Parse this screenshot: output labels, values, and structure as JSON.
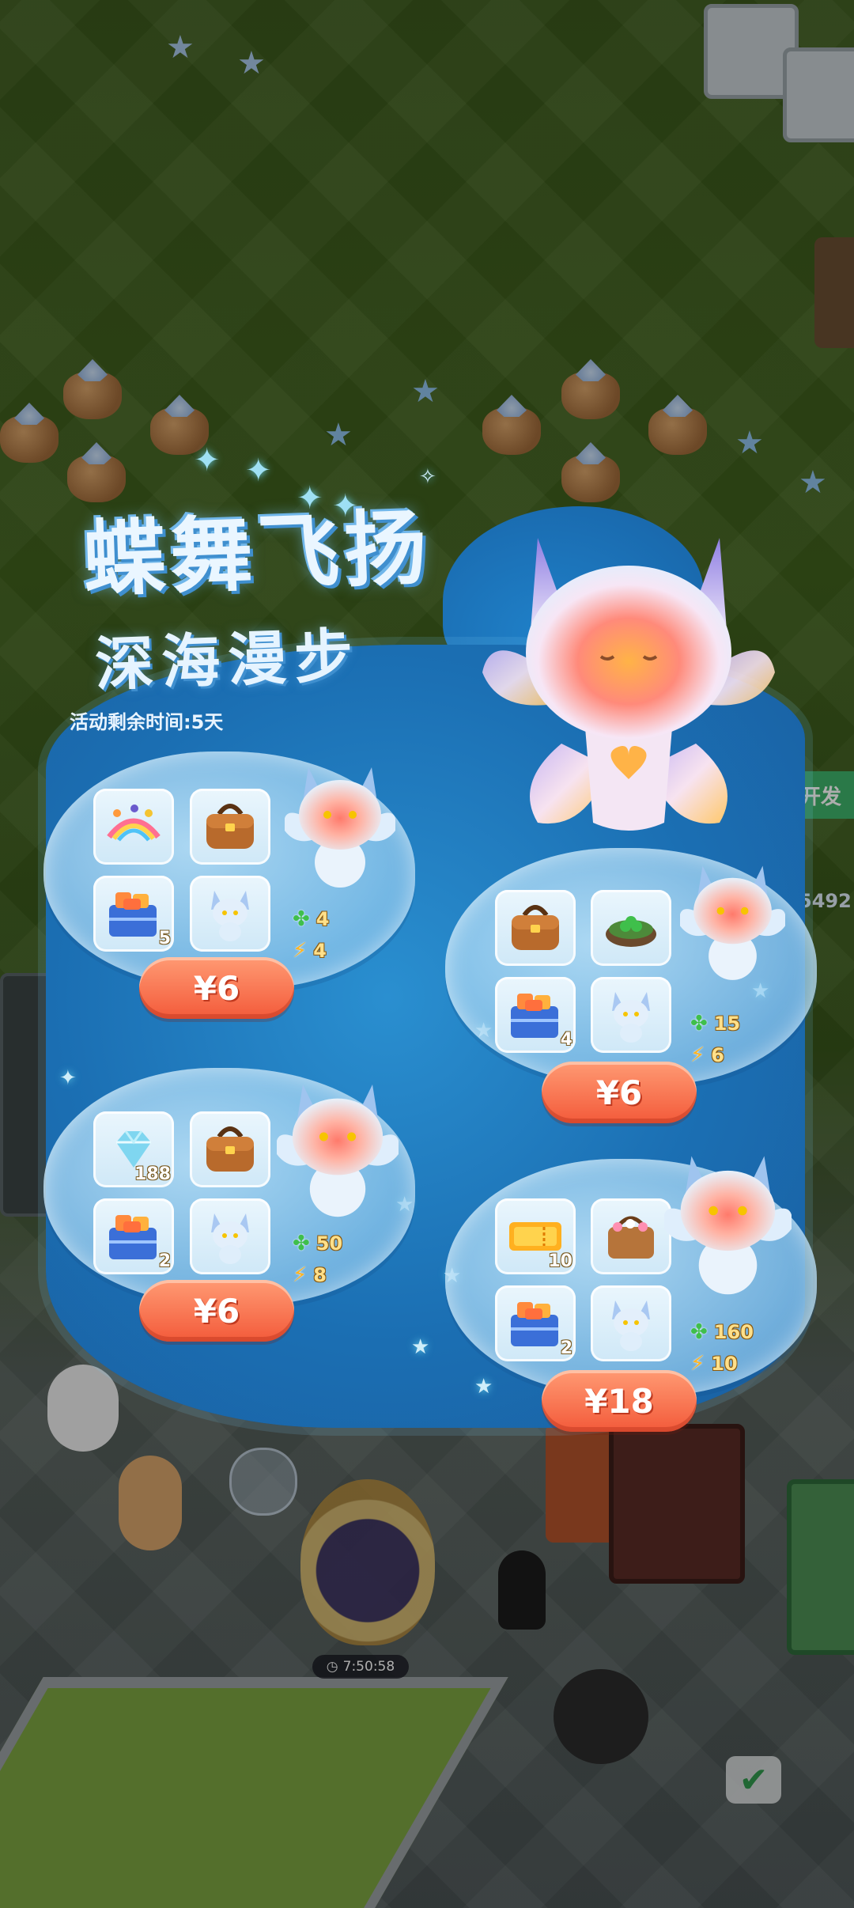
{
  "popup": {
    "title": "蝶舞飞扬",
    "subtitle": "深海漫步",
    "timer": "活动剩余时间:5天"
  },
  "offers": [
    {
      "price": "¥6",
      "clover": "4",
      "bolt": "4",
      "items": [
        {
          "icon": "rainbow-gift-icon",
          "qty": ""
        },
        {
          "icon": "leather-bag-icon",
          "qty": ""
        },
        {
          "icon": "gift-crate-icon",
          "qty": "5"
        },
        {
          "icon": "pet-figure-icon",
          "qty": ""
        }
      ]
    },
    {
      "price": "¥6",
      "clover": "15",
      "bolt": "6",
      "items": [
        {
          "icon": "leather-bag-icon",
          "qty": ""
        },
        {
          "icon": "clover-pot-icon",
          "qty": ""
        },
        {
          "icon": "gift-crate-icon",
          "qty": "4"
        },
        {
          "icon": "pet-figure-icon",
          "qty": ""
        }
      ]
    },
    {
      "price": "¥6",
      "clover": "50",
      "bolt": "8",
      "items": [
        {
          "icon": "diamond-icon",
          "qty": "188"
        },
        {
          "icon": "leather-bag-icon",
          "qty": ""
        },
        {
          "icon": "gift-crate-icon",
          "qty": "2"
        },
        {
          "icon": "pet-figure-icon",
          "qty": ""
        }
      ]
    },
    {
      "price": "¥18",
      "clover": "160",
      "bolt": "10",
      "items": [
        {
          "icon": "ticket-icon",
          "qty": "10"
        },
        {
          "icon": "flower-basket-icon",
          "qty": ""
        },
        {
          "icon": "gift-crate-icon",
          "qty": "2"
        },
        {
          "icon": "pet-figure-icon",
          "qty": ""
        }
      ]
    }
  ],
  "background": {
    "side_button": "开发",
    "side_number": "5492",
    "egg_timer": "7:50:58"
  }
}
